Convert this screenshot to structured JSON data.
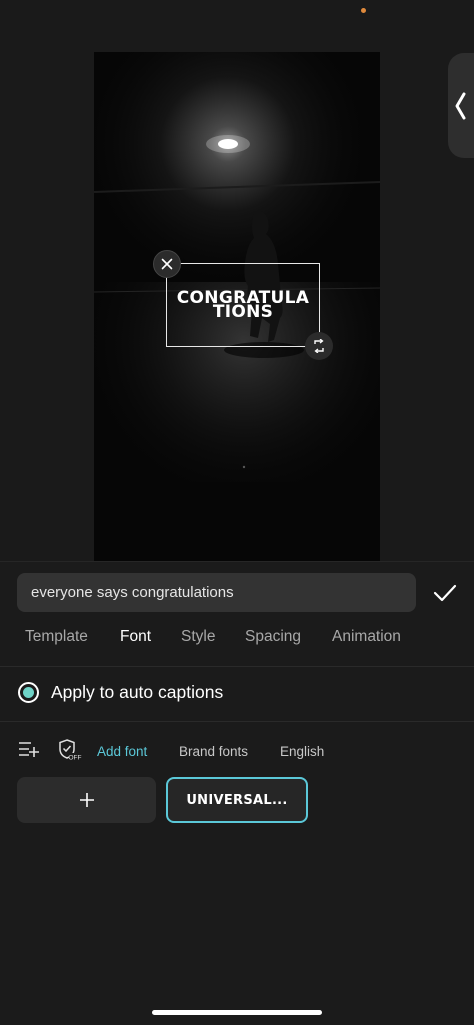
{
  "editor": {
    "caption_overlay_text": "CONGRATULATIONS"
  },
  "text_input": {
    "value": "everyone says congratulations",
    "placeholder": ""
  },
  "tabs": [
    {
      "label": "Template",
      "active": false
    },
    {
      "label": "Font",
      "active": true
    },
    {
      "label": "Style",
      "active": false
    },
    {
      "label": "Spacing",
      "active": false
    },
    {
      "label": "Animation",
      "active": false
    }
  ],
  "auto_captions": {
    "label": "Apply to auto captions",
    "checked": true
  },
  "font_toolbar": {
    "add_font": "Add font",
    "brand_fonts": "Brand fonts",
    "english": "English",
    "shield_badge": "OFF"
  },
  "font_list": [
    {
      "type": "add",
      "icon": "plus-icon"
    },
    {
      "type": "font",
      "name": "UNIVERSAL...",
      "selected": true
    }
  ],
  "colors": {
    "accent": "#5bc8d8",
    "radio_accent": "#6fd3c7",
    "background": "#1a1a1a"
  },
  "icons": {
    "side_handle": "chevron-left-icon",
    "confirm": "checkmark-icon",
    "close": "close-icon",
    "rotate": "rotate-scale-icon",
    "list_add": "list-add-icon",
    "shield": "shield-off-icon"
  }
}
